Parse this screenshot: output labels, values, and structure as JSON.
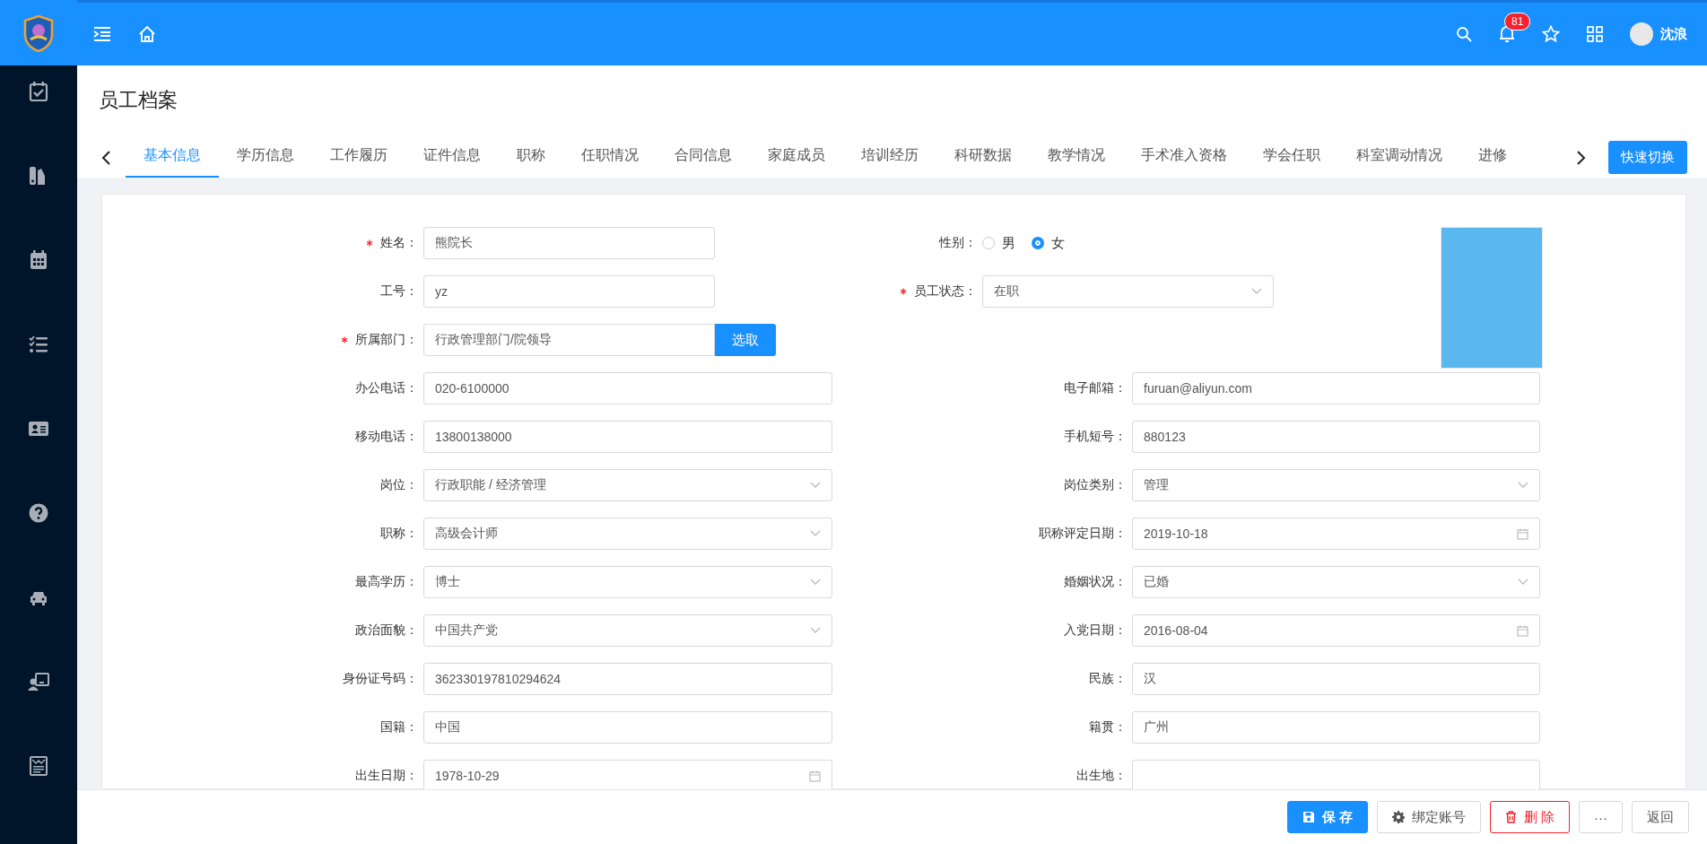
{
  "topbar": {
    "notification_count": "81",
    "user_name": "沈浪"
  },
  "page_title": "员工档案",
  "tabs": [
    {
      "label": "基本信息",
      "selected": true
    },
    {
      "label": "学历信息",
      "selected": false
    },
    {
      "label": "工作履历",
      "selected": false
    },
    {
      "label": "证件信息",
      "selected": false
    },
    {
      "label": "职称",
      "selected": false
    },
    {
      "label": "任职情况",
      "selected": false
    },
    {
      "label": "合同信息",
      "selected": false
    },
    {
      "label": "家庭成员",
      "selected": false
    },
    {
      "label": "培训经历",
      "selected": false
    },
    {
      "label": "科研数据",
      "selected": false
    },
    {
      "label": "教学情况",
      "selected": false
    },
    {
      "label": "手术准入资格",
      "selected": false
    },
    {
      "label": "学会任职",
      "selected": false
    },
    {
      "label": "科室调动情况",
      "selected": false
    },
    {
      "label": "进修",
      "selected": false
    }
  ],
  "quick_switch": "快速切换",
  "header_rows": [
    [
      {
        "label": "姓名：",
        "required": true,
        "kind": "text",
        "value": "熊院长"
      },
      {
        "label": "性别：",
        "required": false,
        "kind": "radio",
        "options": [
          {
            "label": "男",
            "selected": false
          },
          {
            "label": "女",
            "selected": true
          }
        ]
      }
    ],
    [
      {
        "label": "工号：",
        "required": false,
        "kind": "text",
        "value": "yz"
      },
      {
        "label": "员工状态：",
        "required": true,
        "kind": "select",
        "value": "在职"
      }
    ],
    [
      {
        "label": "所属部门：",
        "required": true,
        "kind": "picker",
        "value": "行政管理部门/院领导",
        "button": "选取"
      }
    ]
  ],
  "rows": [
    [
      {
        "label": "办公电话：",
        "required": false,
        "kind": "text",
        "value": "020-6100000"
      },
      {
        "label": "电子邮箱：",
        "required": false,
        "kind": "text",
        "value": "furuan@aliyun.com"
      }
    ],
    [
      {
        "label": "移动电话：",
        "required": false,
        "kind": "text",
        "value": "13800138000"
      },
      {
        "label": "手机短号：",
        "required": false,
        "kind": "text",
        "value": "880123"
      }
    ],
    [
      {
        "label": "岗位：",
        "required": false,
        "kind": "select",
        "value": "行政职能 / 经济管理"
      },
      {
        "label": "岗位类别：",
        "required": false,
        "kind": "select",
        "value": "管理"
      }
    ],
    [
      {
        "label": "职称：",
        "required": false,
        "kind": "select",
        "value": "高级会计师"
      },
      {
        "label": "职称评定日期：",
        "required": false,
        "kind": "date",
        "value": "2019-10-18"
      }
    ],
    [
      {
        "label": "最高学历：",
        "required": false,
        "kind": "select",
        "value": "博士"
      },
      {
        "label": "婚姻状况：",
        "required": false,
        "kind": "select",
        "value": "已婚"
      }
    ],
    [
      {
        "label": "政治面貌：",
        "required": false,
        "kind": "select",
        "value": "中国共产党"
      },
      {
        "label": "入党日期：",
        "required": false,
        "kind": "date",
        "value": "2016-08-04"
      }
    ],
    [
      {
        "label": "身份证号码：",
        "required": false,
        "kind": "text",
        "value": "362330197810294624"
      },
      {
        "label": "民族：",
        "required": false,
        "kind": "text",
        "value": "汉"
      }
    ],
    [
      {
        "label": "国籍：",
        "required": false,
        "kind": "text",
        "value": "中国"
      },
      {
        "label": "籍贯：",
        "required": false,
        "kind": "text",
        "value": "广州"
      }
    ],
    [
      {
        "label": "出生日期：",
        "required": false,
        "kind": "date",
        "value": "1978-10-29"
      },
      {
        "label": "出生地：",
        "required": false,
        "kind": "text"
      }
    ]
  ],
  "footer_buttons": [
    {
      "kind": "save",
      "label": "保 存"
    },
    {
      "kind": "bind",
      "label": "绑定账号"
    },
    {
      "kind": "delete",
      "label": "删 除"
    },
    {
      "kind": "more",
      "label": "···"
    },
    {
      "kind": "back",
      "label": "返回"
    }
  ]
}
